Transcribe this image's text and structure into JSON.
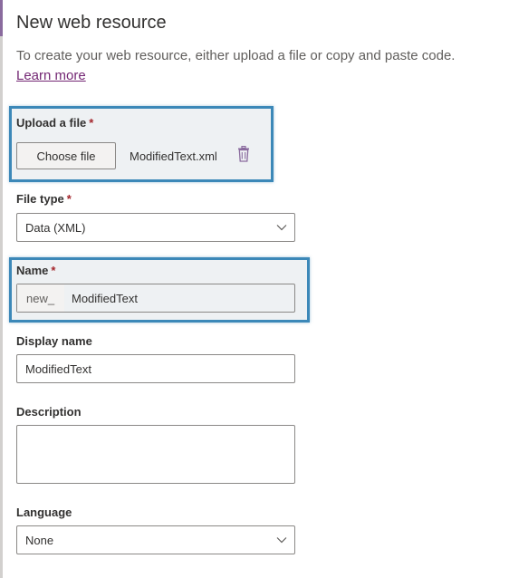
{
  "panel": {
    "title": "New web resource",
    "intro_text": "To create your web resource, either upload a file or copy and paste code.",
    "learn_more_label": "Learn more"
  },
  "upload": {
    "label": "Upload a file",
    "required_mark": "*",
    "choose_button_label": "Choose file",
    "file_name": "ModifiedText.xml"
  },
  "file_type": {
    "label": "File type",
    "required_mark": "*",
    "value": "Data (XML)"
  },
  "name": {
    "label": "Name",
    "required_mark": "*",
    "prefix": "new_",
    "value": "ModifiedText"
  },
  "display_name": {
    "label": "Display name",
    "value": "ModifiedText"
  },
  "description": {
    "label": "Description",
    "value": ""
  },
  "language": {
    "label": "Language",
    "value": "None"
  },
  "colors": {
    "highlight_border": "#3c88b8",
    "link": "#742774",
    "required": "#a4262c",
    "trash_icon": "#8a6b9e"
  },
  "icons": {
    "delete": "trash-icon",
    "dropdown": "chevron-down-icon"
  }
}
